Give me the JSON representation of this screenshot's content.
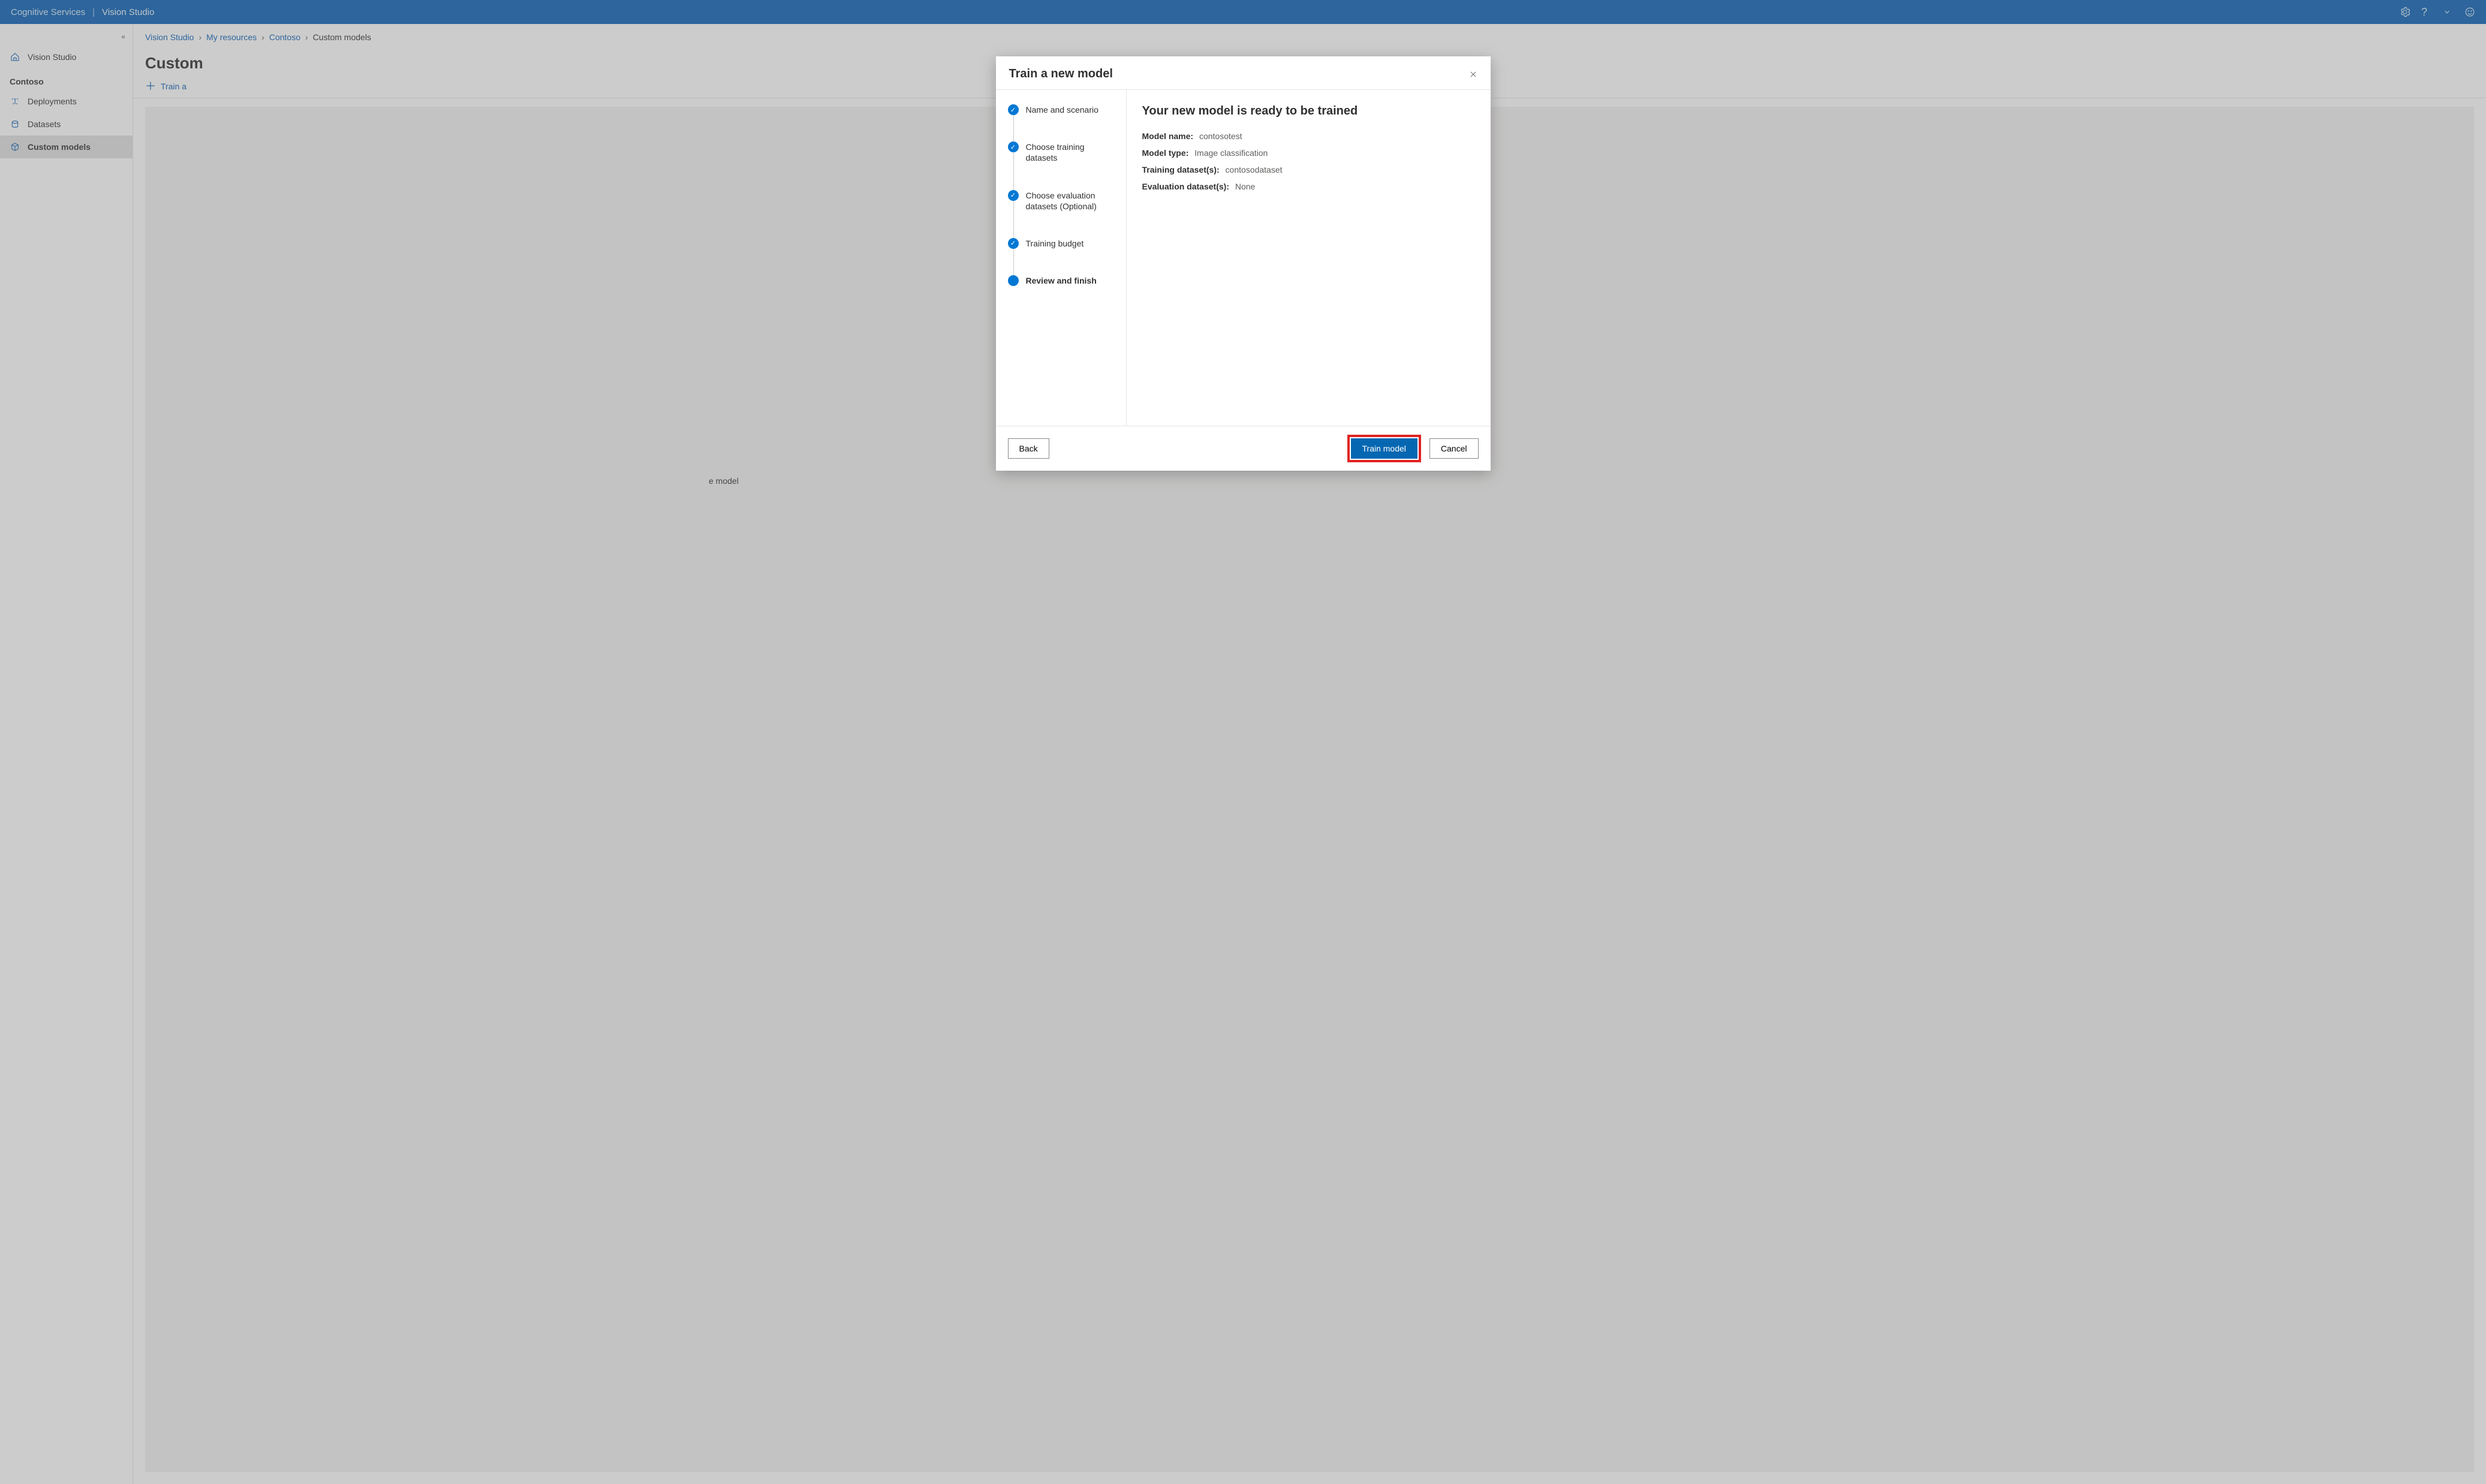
{
  "topbar": {
    "brand_left": "Cognitive Services",
    "brand_right": "Vision Studio"
  },
  "sidebar": {
    "collapse_glyph": "«",
    "items": [
      {
        "label": "Vision Studio",
        "icon": "home-icon",
        "active": false
      },
      {
        "heading": "Contoso"
      },
      {
        "label": "Deployments",
        "icon": "deploy-icon",
        "active": false
      },
      {
        "label": "Datasets",
        "icon": "dataset-icon",
        "active": false
      },
      {
        "label": "Custom models",
        "icon": "model-icon",
        "active": true
      }
    ]
  },
  "breadcrumb": [
    "Vision Studio",
    "My resources",
    "Contoso",
    "Custom models"
  ],
  "page": {
    "title": "Custom",
    "action": "Train a",
    "stage_hint": "e model"
  },
  "dialog": {
    "title": "Train a new model",
    "steps": [
      "Name and scenario",
      "Choose training datasets",
      "Choose evaluation datasets (Optional)",
      "Training budget",
      "Review and finish"
    ],
    "heading": "Your new model is ready to be trained",
    "fields": [
      {
        "k": "Model name:",
        "v": "contosotest"
      },
      {
        "k": "Model type:",
        "v": "Image classification"
      },
      {
        "k": "Training dataset(s):",
        "v": "contosodataset"
      },
      {
        "k": "Evaluation dataset(s):",
        "v": "None"
      }
    ],
    "back": "Back",
    "primary": "Train model",
    "cancel": "Cancel"
  }
}
